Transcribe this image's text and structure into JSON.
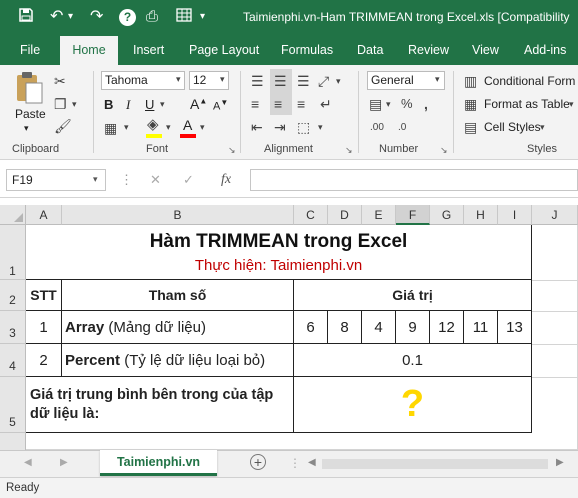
{
  "window": {
    "title": "Taimienphi.vn-Ham TRIMMEAN trong Excel.xls  [Compatibility"
  },
  "tabs": [
    "File",
    "Home",
    "Insert",
    "Page Layout",
    "Formulas",
    "Data",
    "Review",
    "View",
    "Add-ins"
  ],
  "ribbon": {
    "paste_label": "Paste",
    "font_name": "Tahoma",
    "font_size": "12",
    "number_format": "General",
    "conditional_formatting": "Conditional Form",
    "format_as_table": "Format as Table",
    "cell_styles": "Cell Styles",
    "groups": {
      "clipboard": "Clipboard",
      "font": "Font",
      "alignment": "Alignment",
      "number": "Number",
      "styles": "Styles"
    },
    "accent_color": "#217346",
    "highlight_color": "#ffff00",
    "font_color": "#ff0000"
  },
  "formula_bar": {
    "name_box": "F19",
    "fx": "fx",
    "formula": ""
  },
  "columns": [
    "A",
    "B",
    "C",
    "D",
    "E",
    "F",
    "G",
    "H",
    "I",
    "J"
  ],
  "rows": [
    "1",
    "2",
    "3",
    "4",
    "5"
  ],
  "sheet": {
    "title": "Hàm TRIMMEAN trong Excel",
    "subtitle": "Thực hiện: Taimienphi.vn",
    "header_stt": "STT",
    "header_param": "Tham số",
    "header_value": "Giá trị",
    "row3": {
      "stt": "1",
      "param_bold": "Array",
      "param_rest": " (Mảng dữ liệu)",
      "values": [
        "6",
        "8",
        "4",
        "9",
        "12",
        "11",
        "13"
      ]
    },
    "row4": {
      "stt": "2",
      "param_bold": "Percent",
      "param_rest": " (Tỷ lệ dữ liệu loại bỏ)",
      "value": "0.1"
    },
    "row5": {
      "label": "Giá trị trung bình bên trong của tập dữ liệu là:",
      "result": "?"
    },
    "subtitle_color": "#c00000",
    "result_color": "#ffd700"
  },
  "sheet_tab": {
    "name": "Taimienphi.vn"
  },
  "status": {
    "text": "Ready"
  }
}
